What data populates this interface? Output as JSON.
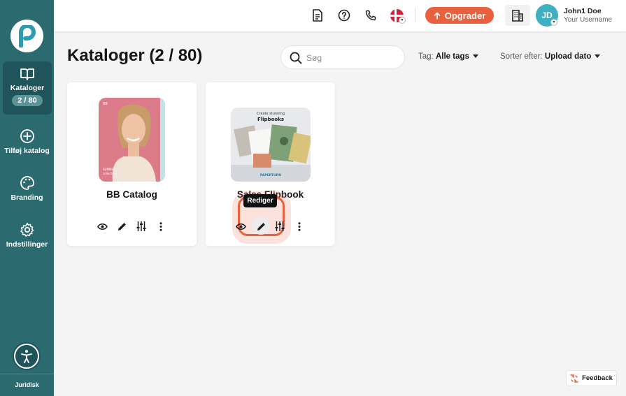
{
  "sidebar": {
    "items": [
      {
        "label": "Kataloger",
        "badge": "2 / 80",
        "icon": "book-open-icon",
        "active": true
      },
      {
        "label": "Tilføj katalog",
        "icon": "plus-circle-icon"
      },
      {
        "label": "Branding",
        "icon": "palette-icon"
      },
      {
        "label": "Indstillinger",
        "icon": "gear-icon"
      }
    ],
    "footer_label": "Juridisk"
  },
  "topbar": {
    "upgrade_label": "Opgrader",
    "user_initials": "JD",
    "user_name": "John1 Doe",
    "user_subtitle": "Your Username",
    "icons": [
      "document-icon",
      "help-icon",
      "phone-icon",
      "denmark-flag-icon",
      "building-icon"
    ]
  },
  "main": {
    "title": "Kataloger (2 / 80)",
    "search_placeholder": "Søg",
    "tag_filter": {
      "label": "Tag:",
      "value": "Alle tags"
    },
    "sort": {
      "label": "Sorter efter:",
      "value": "Upload dato"
    }
  },
  "catalogs": [
    {
      "title": "BB Catalog",
      "cover_text": [
        "BB",
        "SUMMER",
        "collection"
      ]
    },
    {
      "title": "Sales Flipbook",
      "cover_text": [
        "Create stunning",
        "Flipbooks",
        "PAPERTURN"
      ]
    }
  ],
  "tooltip": "Rediger",
  "feedback_label": "Feedback",
  "colors": {
    "sidebar": "#2b6b70",
    "sidebar_active": "#1f555a",
    "accent": "#e8603c",
    "avatar": "#3fb0c1"
  }
}
